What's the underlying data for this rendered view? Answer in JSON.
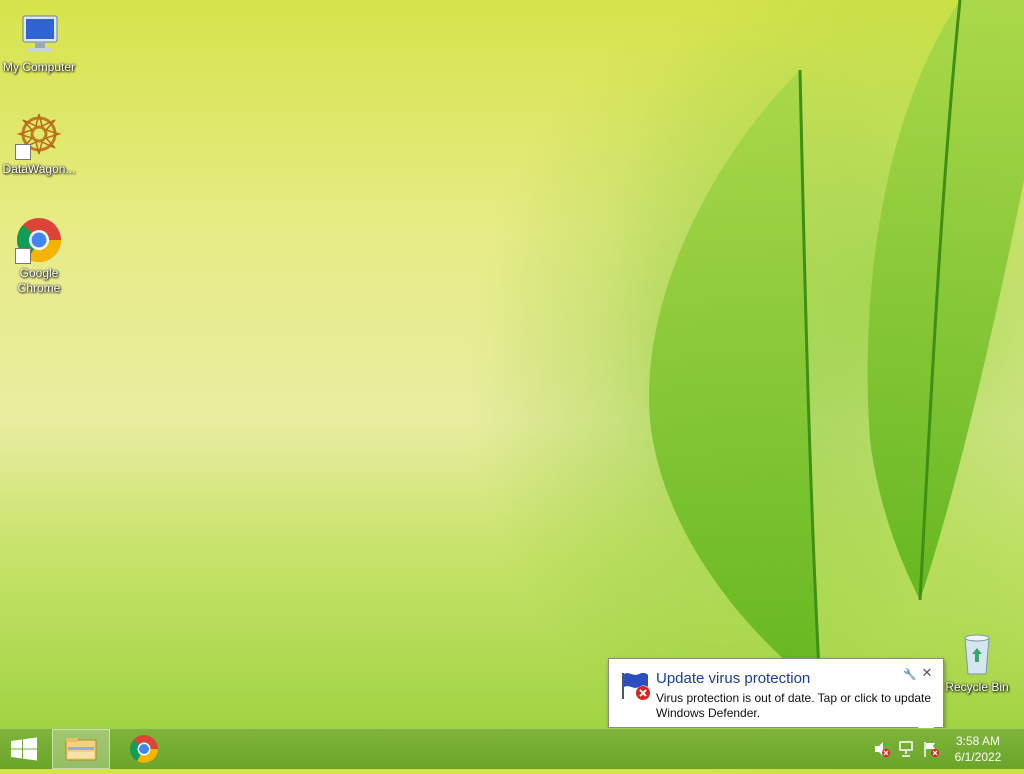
{
  "desktop": {
    "icons": [
      {
        "label": "My Computer"
      },
      {
        "label": "DataWagon..."
      },
      {
        "label": "Google Chrome"
      },
      {
        "label": "Recycle Bin"
      }
    ]
  },
  "notification": {
    "title": "Update virus protection",
    "message": "Virus protection is out of date. Tap or click to update Windows Defender."
  },
  "taskbar": {
    "time": "3:58 AM",
    "date": "6/1/2022"
  },
  "colors": {
    "accent_title": "#1a3e9e",
    "taskbar": "#6aa52a"
  }
}
